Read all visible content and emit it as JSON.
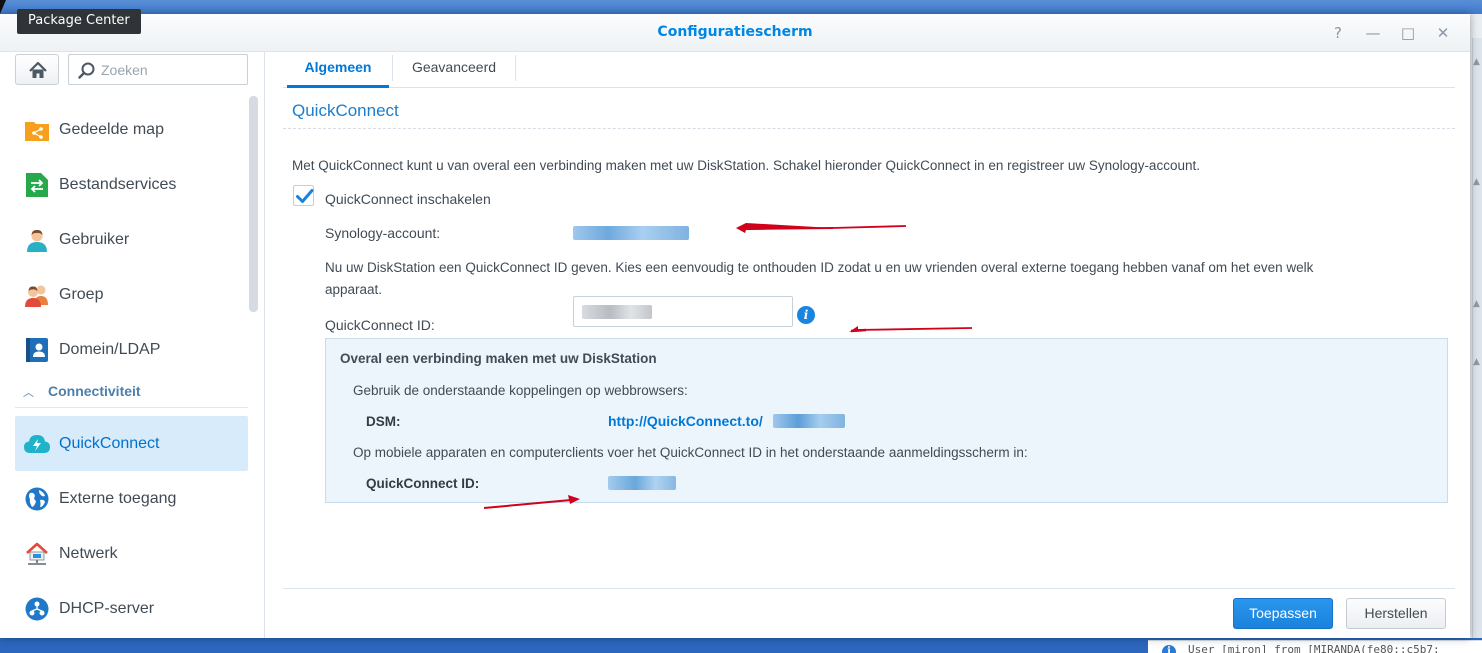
{
  "window": {
    "title": "Configuratiescherm",
    "controls": [
      "?",
      "—",
      "□",
      "✕"
    ]
  },
  "tooltip": "Package Center",
  "sidebar": {
    "search_placeholder": "Zoeken",
    "items": [
      {
        "label": "Gedeelde map",
        "icon": "shared-folder-icon"
      },
      {
        "label": "Bestandservices",
        "icon": "file-services-icon"
      },
      {
        "label": "Gebruiker",
        "icon": "user-icon"
      },
      {
        "label": "Groep",
        "icon": "group-icon"
      },
      {
        "label": "Domein/LDAP",
        "icon": "domain-ldap-icon"
      }
    ],
    "section": "Connectiviteit",
    "connectivity_items": [
      {
        "label": "QuickConnect",
        "icon": "quickconnect-icon",
        "active": true
      },
      {
        "label": "Externe toegang",
        "icon": "external-access-icon"
      },
      {
        "label": "Netwerk",
        "icon": "network-icon"
      },
      {
        "label": "DHCP-server",
        "icon": "dhcp-server-icon"
      }
    ]
  },
  "tabs": [
    {
      "label": "Algemeen",
      "active": true
    },
    {
      "label": "Geavanceerd",
      "active": false
    }
  ],
  "main": {
    "section_title": "QuickConnect",
    "intro": "Met QuickConnect kunt u van overal een verbinding maken met uw DiskStation. Schakel hieronder QuickConnect in en registreer uw Synology-account.",
    "enable_label": "QuickConnect inschakelen",
    "enable_checked": true,
    "account_label": "Synology-account:",
    "id_hint_line1": "Nu uw DiskStation een QuickConnect ID geven. Kies een eenvoudig te onthouden ID zodat u en uw vrienden overal externe toegang hebben vanaf om het even welk",
    "id_hint_line2": "apparaat.",
    "id_label": "QuickConnect ID:"
  },
  "panel": {
    "title": "Overal een verbinding maken met uw DiskStation",
    "browser_text": "Gebruik de onderstaande koppelingen op webbrowsers:",
    "dsm_label": "DSM:",
    "dsm_link": "http://QuickConnect.to/",
    "mobile_text": "Op mobiele apparaten en computerclients voer het QuickConnect ID in het onderstaande aanmeldingsscherm in:",
    "qc_id_label": "QuickConnect ID:"
  },
  "buttons": {
    "apply": "Toepassen",
    "reset": "Herstellen"
  },
  "background_log": "User [miron] from [MIRANDA(fe80::c5b7:",
  "colors": {
    "accent": "#0078d7",
    "annotation_arrow": "#d0021b",
    "panel_bg": "#edf5fc"
  }
}
